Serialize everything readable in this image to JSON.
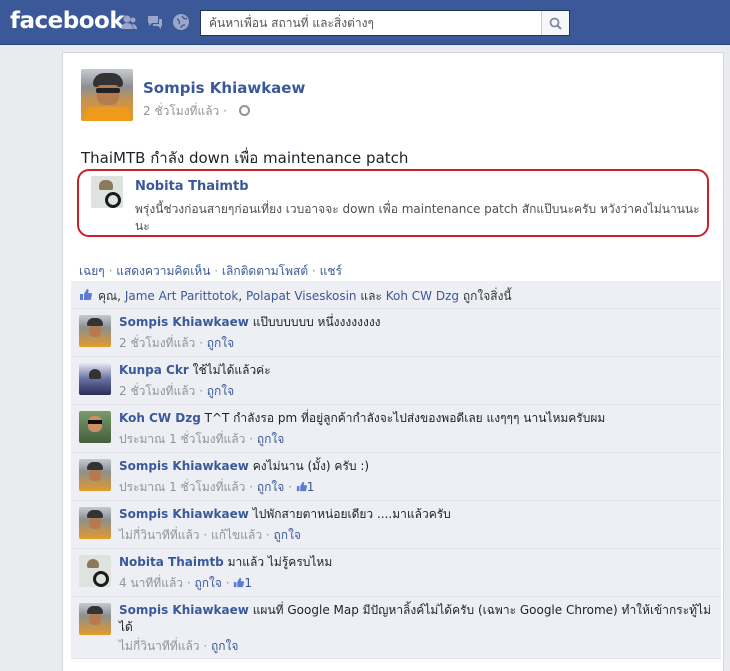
{
  "header": {
    "logo": "facebook",
    "search_placeholder": "ค้นหาเพื่อน สถานที่ และสิ่งต่างๆ",
    "brand_color": "#3b5998"
  },
  "post": {
    "author": "Sompis Khiawkaew",
    "time": "2 ชั่วโมงที่แล้ว",
    "separator": "·",
    "status": "ThaiMTB กำลัง down เพื่อ maintenance patch",
    "shared": {
      "author": "Nobita Thaimtb",
      "text": "พรุ่งนี้ช่วงก่อนสายๆก่อนเที่ยง เวบอาจจะ down เพื่อ maintenance patch สักแป๊บนะครับ หวังว่าคงไม่นานนะ นะ"
    },
    "actions": {
      "share_out": "เฉยๆ",
      "comment": "แสดงความคิดเห็น",
      "unfollow": "เลิกติดตามโพสต์",
      "share": "แชร์",
      "sep": "·"
    },
    "likes": {
      "prefix": "คุณ,",
      "person1": "Jame Art Parittotok",
      "comma": ",",
      "person2": "Polapat Viseskosin",
      "and": "และ",
      "person3": "Koh CW Dzg",
      "suffix": "ถูกใจสิ่งนี้"
    }
  },
  "comments": [
    {
      "name": "Sompis Khiawkaew",
      "text": "แป๊บบบบบบ หนึ่งงงงงงงง",
      "time": "2 ชั่วโมงที่แล้ว",
      "like": "ถูกใจ",
      "extra": "",
      "count": "",
      "avatar": "sompis"
    },
    {
      "name": "Kunpa Ckr",
      "text": "ใช้ไม่ได้แล้วค่ะ",
      "time": "2 ชั่วโมงที่แล้ว",
      "like": "ถูกใจ",
      "extra": "",
      "count": "",
      "avatar": "kunpa"
    },
    {
      "name": "Koh CW Dzg",
      "text": "T^T กำลังรอ pm ที่อยู่ลูกค้ากำลังจะไปส่งของพอดีเลย แงๆๆๆ นานไหมครับผม",
      "time": "ประมาณ 1 ชั่วโมงที่แล้ว",
      "like": "ถูกใจ",
      "extra": "",
      "count": "",
      "avatar": "koh"
    },
    {
      "name": "Sompis Khiawkaew",
      "text": "คงไม่นาน (มั้ง) ครับ :)",
      "time": "ประมาณ 1 ชั่วโมงที่แล้ว",
      "like": "ถูกใจ",
      "extra": "",
      "count": "1",
      "avatar": "sompis"
    },
    {
      "name": "Sompis Khiawkaew",
      "text": "ไปพักสายตาหน่อยเดียว ....มาแล้วครับ",
      "time": "ไม่กี่วินาทีที่แล้ว",
      "like": "ถูกใจ",
      "extra": "แก้ไขแล้ว",
      "count": "",
      "avatar": "sompis"
    },
    {
      "name": "Nobita Thaimtb",
      "text": "มาแล้ว ไม่รู้ครบไหม",
      "time": "4 นาทีที่แล้ว",
      "like": "ถูกใจ",
      "extra": "",
      "count": "1",
      "avatar": "nobita"
    },
    {
      "name": "Sompis Khiawkaew",
      "text": "แผนที่ Google Map มีปัญหาลิ้งค์ไม่ได้ครับ (เฉพาะ Google Chrome) ทำให้เข้ากระทู้ไม่ได้",
      "time": "ไม่กี่วินาทีที่แล้ว",
      "like": "ถูกใจ",
      "extra": "",
      "count": "",
      "avatar": "sompis"
    }
  ]
}
